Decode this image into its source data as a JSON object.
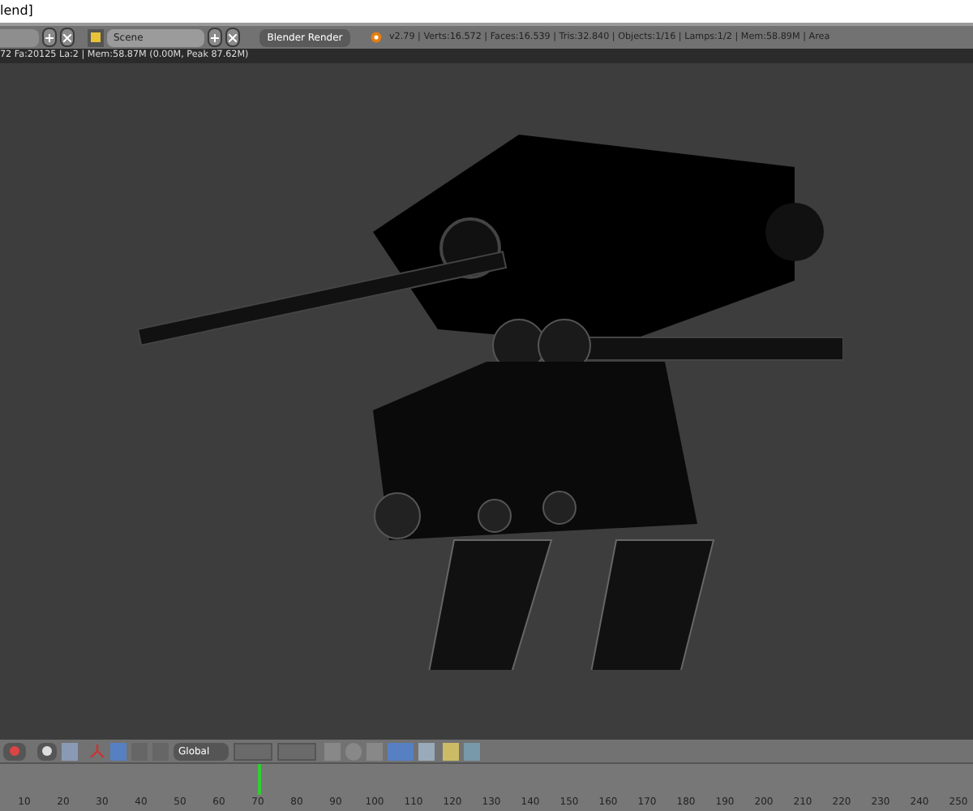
{
  "window": {
    "title": "lend]"
  },
  "info_header": {
    "scene": "Scene",
    "render_engine": "Blender Render",
    "stats": "v2.79 | Verts:16.572 | Faces:16.539 | Tris:32.840 | Objects:1/16 | Lamps:1/2 | Mem:58.89M | Area"
  },
  "viewport": {
    "render_info": "72 Fa:20125 La:2 | Mem:58.87M (0.00M, Peak 87.62M)"
  },
  "view3d_header": {
    "orientation": "Global"
  },
  "timeline": {
    "playhead": {
      "level": 0.265
    },
    "labels": [
      "10",
      "20",
      "30",
      "40",
      "50",
      "60",
      "70",
      "80",
      "90",
      "100",
      "110",
      "120",
      "130",
      "140",
      "150",
      "160",
      "170",
      "180",
      "190",
      "200",
      "210",
      "220",
      "230",
      "240",
      "250"
    ]
  }
}
